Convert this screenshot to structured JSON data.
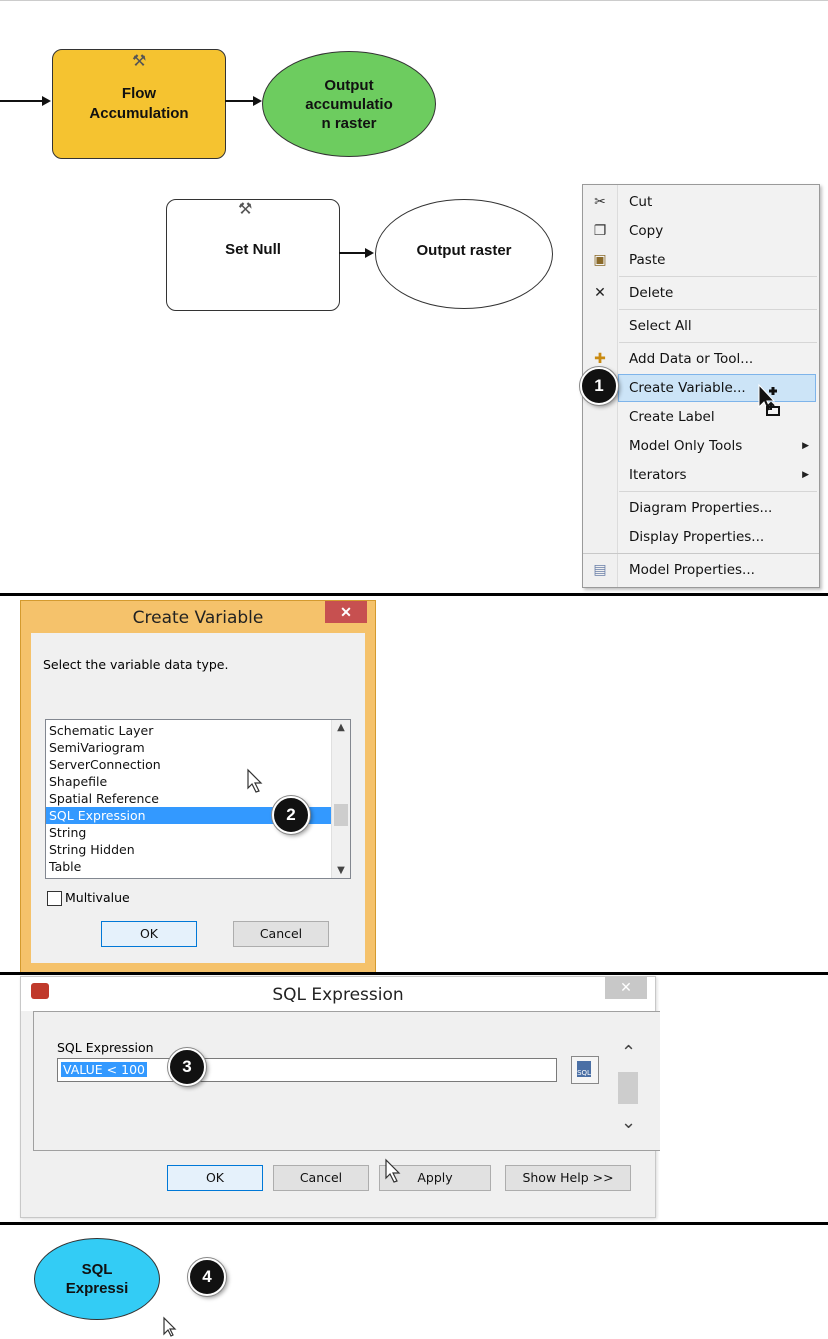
{
  "model": {
    "flow_accumulation": "Flow Accumulation",
    "output_accumulation": "Output accumulatio n raster",
    "set_null": "Set Null",
    "output_raster": "Output raster"
  },
  "context_menu": {
    "items": [
      {
        "label": "Cut",
        "icon": "scissors-icon"
      },
      {
        "label": "Copy",
        "icon": "copy-icon"
      },
      {
        "label": "Paste",
        "icon": "paste-icon"
      },
      {
        "label": "Delete",
        "icon": "delete-icon"
      },
      {
        "label": "Select All",
        "icon": ""
      },
      {
        "label": "Add Data or Tool...",
        "icon": "add-icon"
      },
      {
        "label": "Create Variable...",
        "icon": "",
        "highlighted": true
      },
      {
        "label": "Create Label",
        "icon": ""
      },
      {
        "label": "Model Only Tools",
        "icon": "",
        "submenu": true
      },
      {
        "label": "Iterators",
        "icon": "",
        "submenu": true
      },
      {
        "label": "Diagram Properties...",
        "icon": ""
      },
      {
        "label": "Display Properties...",
        "icon": ""
      },
      {
        "label": "Model Properties...",
        "icon": "model-properties-icon"
      }
    ]
  },
  "steps": [
    "1",
    "2",
    "3",
    "4"
  ],
  "create_variable": {
    "title": "Create Variable",
    "close": "✕",
    "prompt": "Select the variable data type.",
    "items": [
      "Schematic Layer",
      "SemiVariogram",
      "ServerConnection",
      "Shapefile",
      "Spatial Reference",
      "SQL Expression",
      "String",
      "String Hidden",
      "Table"
    ],
    "selected": "SQL Expression",
    "multivalue_label": "Multivalue",
    "ok": "OK",
    "cancel": "Cancel"
  },
  "sql_expression": {
    "title": "SQL Expression",
    "close": "✕",
    "field_label": "SQL Expression",
    "value": "VALUE < 100",
    "ok": "OK",
    "cancel": "Cancel",
    "apply": "Apply",
    "show_help": "Show Help >>"
  },
  "result_node": {
    "label": "SQL Expressi"
  },
  "colors": {
    "tool_fill": "#f5c330",
    "output_fill": "#6dcc5f",
    "sql_node_fill": "#33ccf5",
    "selection": "#3399ff",
    "menu_highlight": "#cce4f7"
  }
}
